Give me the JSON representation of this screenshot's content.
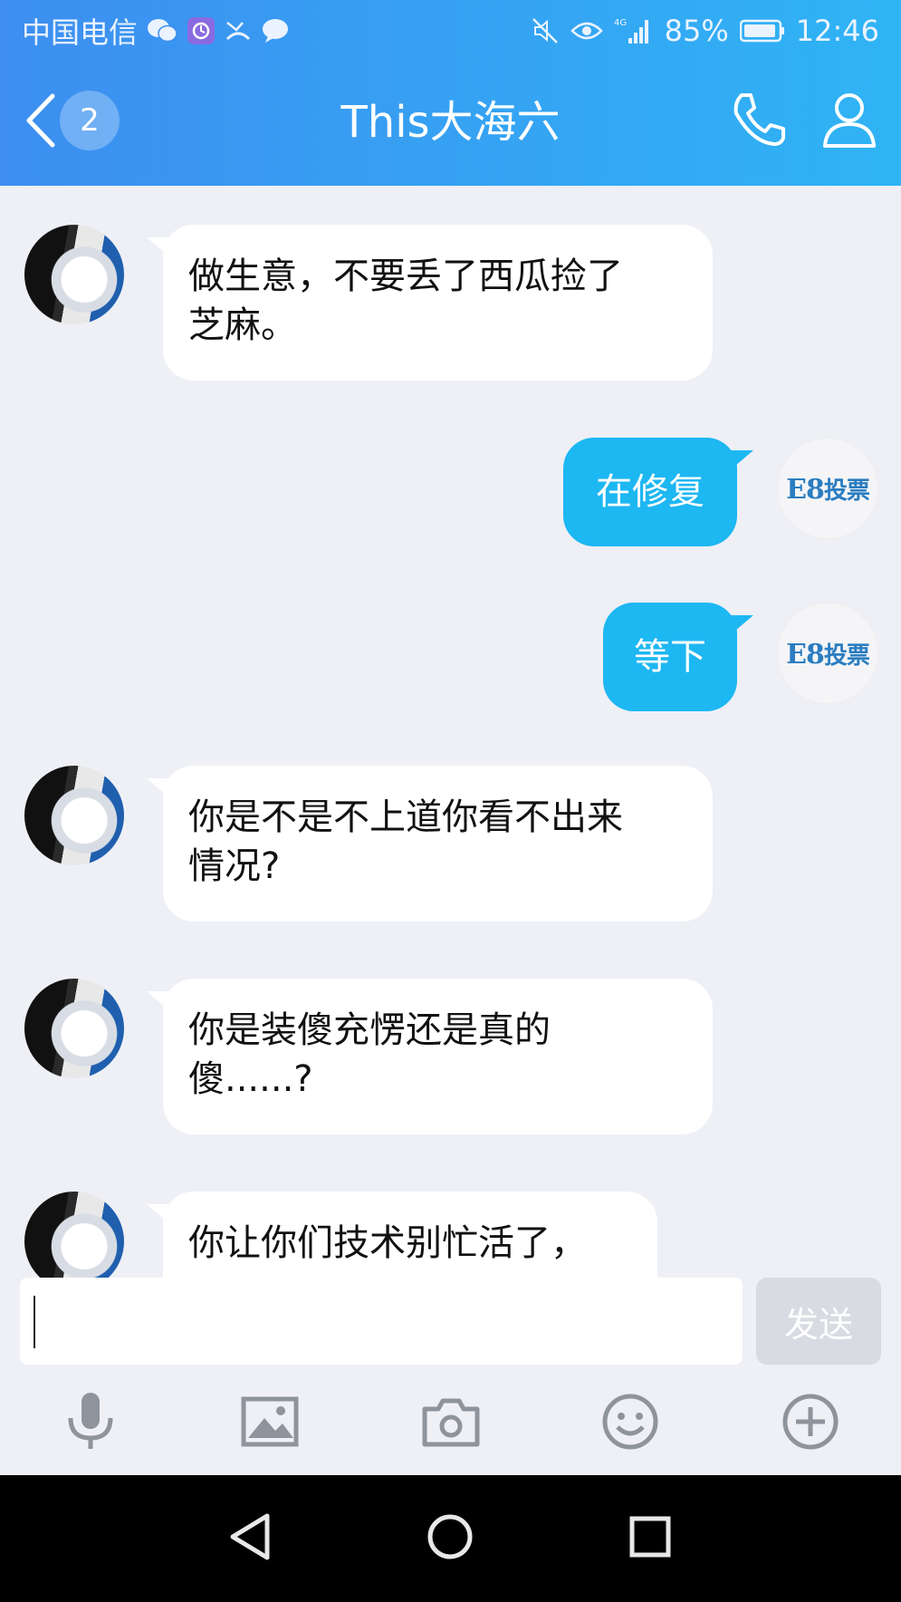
{
  "status_bar": {
    "carrier": "中国电信",
    "battery": "85%",
    "time": "12:46",
    "network": "4G",
    "icons": [
      "wechat-icon",
      "app-icon",
      "missed-call-icon",
      "chat-icon",
      "mute-icon",
      "eye-icon",
      "signal-icon",
      "battery-icon"
    ]
  },
  "header": {
    "back_badge": "2",
    "title": "This大海六",
    "icons": [
      "back-icon",
      "phone-icon",
      "profile-icon"
    ]
  },
  "messages": [
    {
      "side": "left",
      "lines": [
        "做生意，不要丢了西瓜捡了",
        "芝麻。"
      ]
    },
    {
      "side": "right",
      "lines": [
        "在修复"
      ],
      "avatar_text": "E8",
      "avatar_sub": "投票"
    },
    {
      "side": "right",
      "lines": [
        "等下"
      ],
      "avatar_text": "E8",
      "avatar_sub": "投票"
    },
    {
      "side": "left",
      "lines": [
        "你是不是不上道你看不出来",
        "情况?"
      ]
    },
    {
      "side": "left",
      "lines": [
        "你是装傻充愣还是真的",
        "傻......?"
      ]
    },
    {
      "side": "left",
      "lines": [
        "你让你们技术别忙活了，"
      ]
    }
  ],
  "input": {
    "value": "",
    "send_label": "发送"
  },
  "toolbar": [
    "microphone-icon",
    "image-icon",
    "camera-icon",
    "emoji-icon",
    "plus-icon"
  ],
  "colors": {
    "header_gradient_start": "#3d8ef0",
    "header_gradient_end": "#2fb4f5",
    "outgoing_bubble": "#1db7f2",
    "incoming_bubble": "#ffffff",
    "chat_background": "#eef0f6"
  }
}
